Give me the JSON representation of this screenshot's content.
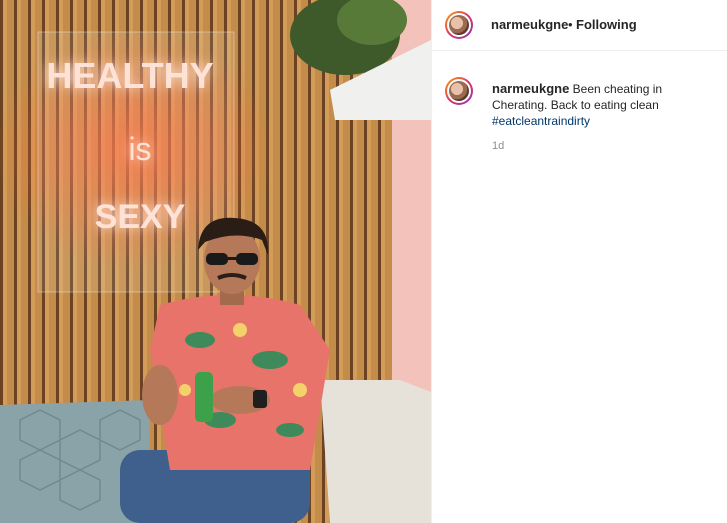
{
  "post": {
    "photo_alt": "Man in floral shirt holding a green juice bottle in front of a neon sign",
    "neon_sign": {
      "line1": "HEALTHY",
      "line2": "is",
      "line3": "SEXY"
    }
  },
  "header": {
    "username": "narmeukgne",
    "separator": "•",
    "follow_status": "Following"
  },
  "caption": {
    "username": "narmeukgne",
    "text": "Been cheating in Cherating. Back to eating clean",
    "hashtag": "#eatcleantraindirty"
  },
  "meta": {
    "timestamp": "1d"
  },
  "colors": {
    "neon": "#ffd7c7",
    "neon_glow": "#ff5a2a",
    "wall_wood": "#c9924f",
    "hashtag": "#00376b",
    "avatar_ring": "#e1306c"
  }
}
